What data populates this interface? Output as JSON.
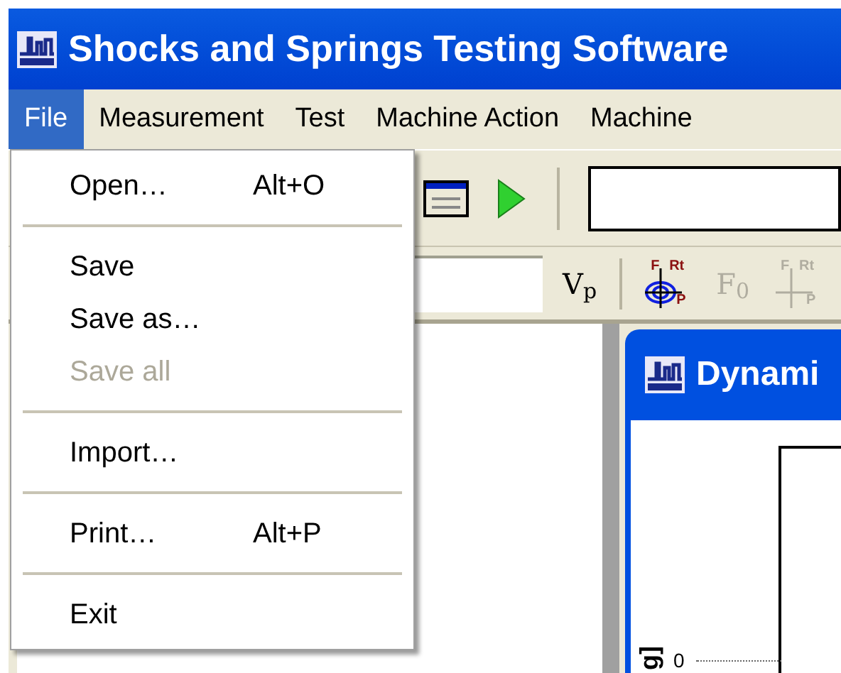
{
  "window": {
    "title": "Shocks and Springs Testing Software"
  },
  "menu_bar": [
    {
      "label": "File",
      "selected": true
    },
    {
      "label": "Measurement",
      "selected": false
    },
    {
      "label": "Test",
      "selected": false
    },
    {
      "label": "Machine Action",
      "selected": false
    },
    {
      "label": "Machine",
      "selected": false
    }
  ],
  "file_menu": [
    {
      "kind": "item",
      "label": "Open…",
      "shortcut": "Alt+O",
      "disabled": false
    },
    {
      "kind": "separator"
    },
    {
      "kind": "item",
      "label": "Save",
      "disabled": false
    },
    {
      "kind": "item",
      "label": "Save as…",
      "disabled": false
    },
    {
      "kind": "item",
      "label": "Save all",
      "disabled": true
    },
    {
      "kind": "separator"
    },
    {
      "kind": "item",
      "label": "Import…",
      "disabled": false
    },
    {
      "kind": "separator"
    },
    {
      "kind": "item",
      "label": "Print…",
      "shortcut": "Alt+P",
      "disabled": false
    },
    {
      "kind": "separator"
    },
    {
      "kind": "item",
      "label": "Exit",
      "disabled": false
    }
  ],
  "toolbar_2": [
    {
      "kind": "text",
      "label": "V$_{p}$",
      "disabled": false
    },
    {
      "kind": "separator"
    },
    {
      "kind": "target",
      "labels": [
        "F",
        "Rt",
        "P"
      ],
      "disabled": false
    },
    {
      "kind": "text",
      "label": "F$_{0}$",
      "disabled": true
    },
    {
      "kind": "cross",
      "labels": [
        "F",
        "Rt",
        "P"
      ],
      "disabled": true
    }
  ],
  "child_window": {
    "title": "Dynami",
    "y_axis_label": "g]",
    "y_tick": "0"
  }
}
